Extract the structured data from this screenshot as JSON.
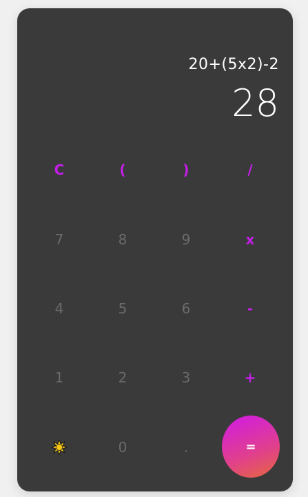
{
  "display": {
    "expression": "20+(5x2)-2",
    "result": "28"
  },
  "keys": {
    "row1": [
      "C",
      "(",
      ")",
      "/"
    ],
    "row2": [
      "7",
      "8",
      "9",
      "x"
    ],
    "row3": [
      "4",
      "5",
      "6",
      "-"
    ],
    "row4": [
      "1",
      "2",
      "3",
      "+"
    ],
    "row5": [
      "0",
      ".",
      "="
    ]
  },
  "icons": {
    "theme_toggle": "sun-icon"
  },
  "colors": {
    "background": "#3a3a3a",
    "operator": "#c41ee6",
    "digit": "#6b6b6b",
    "equals_gradient_start": "#d11ae6",
    "equals_gradient_end": "#e6683d"
  }
}
